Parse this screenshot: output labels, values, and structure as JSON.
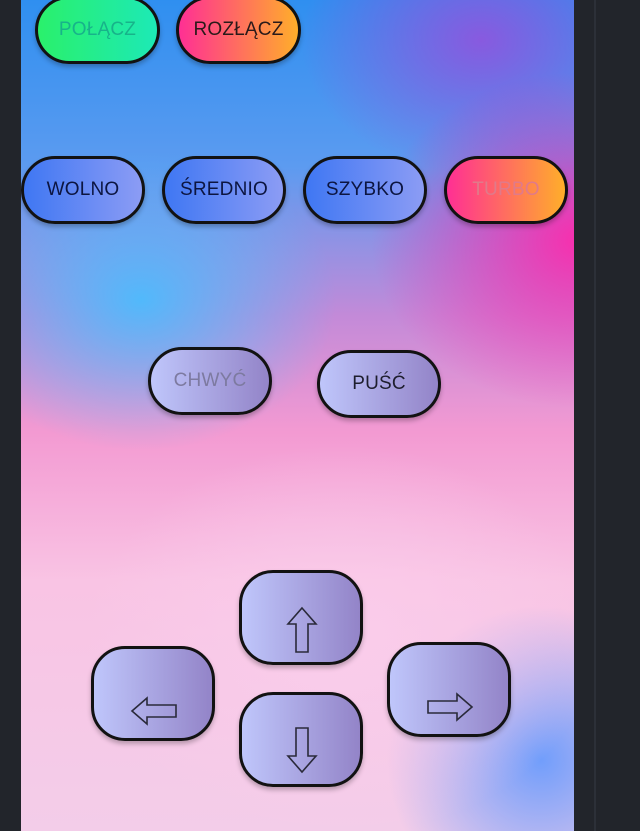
{
  "colors": {
    "window_background": "#22252b",
    "button_border": "#121212",
    "connect_gradient": [
      "#2af06b",
      "#1de9b6"
    ],
    "disconnect_gradient": [
      "#ff2f94",
      "#ffae2a"
    ],
    "speed_gradient": [
      "#3f77f3",
      "#8c9cf4"
    ],
    "control_gradient": [
      "#bfc6fb",
      "#9384c8"
    ]
  },
  "connection": {
    "connect_label": "POŁĄCZ",
    "disconnect_label": "ROZŁĄCZ"
  },
  "speed": {
    "slow_label": "WOLNO",
    "medium_label": "ŚREDNIO",
    "fast_label": "SZYBKO",
    "turbo_label": "TURBO"
  },
  "gripper": {
    "grab_label": "CHWYĆ",
    "release_label": "PUŚĆ"
  },
  "direction_pad": {
    "up_icon": "arrow-up-icon",
    "down_icon": "arrow-down-icon",
    "left_icon": "arrow-left-icon",
    "right_icon": "arrow-right-icon"
  }
}
